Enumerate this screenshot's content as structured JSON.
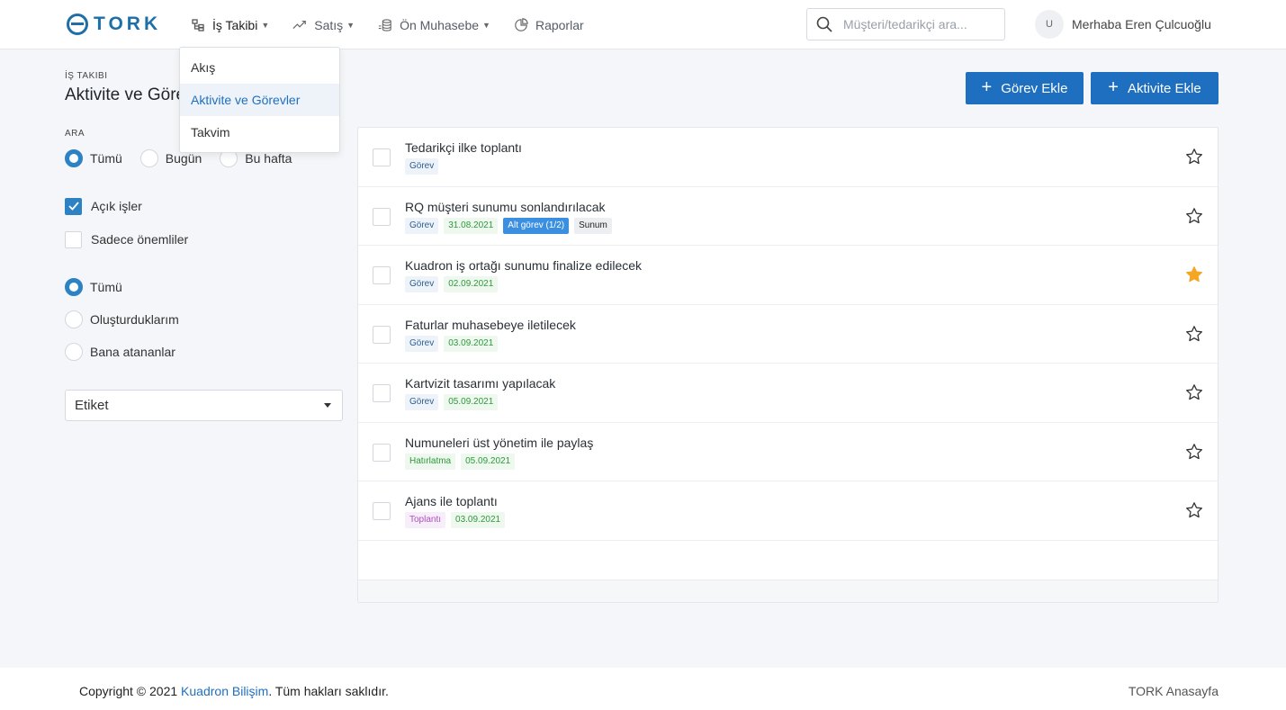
{
  "brand": {
    "name": "TORK",
    "accent": "#1e6fa8"
  },
  "nav": {
    "items": [
      {
        "label": "İş Takibi",
        "icon": "tasks-icon",
        "has_dropdown": true
      },
      {
        "label": "Satış",
        "icon": "trend-up-icon",
        "has_dropdown": true
      },
      {
        "label": "Ön Muhasebe",
        "icon": "coins-icon",
        "has_dropdown": true
      },
      {
        "label": "Raporlar",
        "icon": "pie-chart-icon",
        "has_dropdown": false
      }
    ],
    "dropdown": {
      "items": [
        "Akış",
        "Aktivite ve Görevler",
        "Takvim"
      ],
      "selected": "Aktivite ve Görevler"
    }
  },
  "search": {
    "placeholder": "Müşteri/tedarikçi ara..."
  },
  "user": {
    "initial": "U",
    "greeting": "Merhaba Eren Çulcuoğlu"
  },
  "page": {
    "breadcrumb": "İŞ TAKIBI",
    "title": "Aktivite ve Görevler"
  },
  "filters": {
    "search_label": "ARA",
    "period": {
      "options": [
        "Tümü",
        "Bugün",
        "Bu hafta"
      ],
      "selected": "Tümü"
    },
    "open_tasks": {
      "label": "Açık işler",
      "checked": true
    },
    "important_only": {
      "label": "Sadece önemliler",
      "checked": false
    },
    "owner": {
      "options": [
        "Tümü",
        "Oluşturduklarım",
        "Bana atananlar"
      ],
      "selected": "Tümü"
    },
    "tag_select": {
      "label": "Etiket"
    }
  },
  "actions": {
    "add_task": "Görev Ekle",
    "add_activity": "Aktivite Ekle"
  },
  "tasks": [
    {
      "title": "Tedarikçi ilke toplantı",
      "tags": [
        {
          "text": "Görev",
          "kind": "gorev"
        }
      ],
      "starred": false
    },
    {
      "title": "RQ müşteri sunumu sonlandırılacak",
      "tags": [
        {
          "text": "Görev",
          "kind": "gorev"
        },
        {
          "text": "31.08.2021",
          "kind": "date"
        },
        {
          "text": "Alt görev (1/2)",
          "kind": "alt"
        },
        {
          "text": "Sunum",
          "kind": "sunum"
        }
      ],
      "starred": false
    },
    {
      "title": "Kuadron iş ortağı sunumu finalize edilecek",
      "tags": [
        {
          "text": "Görev",
          "kind": "gorev"
        },
        {
          "text": "02.09.2021",
          "kind": "date"
        }
      ],
      "starred": true
    },
    {
      "title": "Faturlar muhasebeye iletilecek",
      "tags": [
        {
          "text": "Görev",
          "kind": "gorev"
        },
        {
          "text": "03.09.2021",
          "kind": "date"
        }
      ],
      "starred": false
    },
    {
      "title": "Kartvizit tasarımı yapılacak",
      "tags": [
        {
          "text": "Görev",
          "kind": "gorev"
        },
        {
          "text": "05.09.2021",
          "kind": "date"
        }
      ],
      "starred": false
    },
    {
      "title": "Numuneleri üst yönetim ile paylaş",
      "tags": [
        {
          "text": "Hatırlatma",
          "kind": "hatirlatma"
        },
        {
          "text": "05.09.2021",
          "kind": "date"
        }
      ],
      "starred": false
    },
    {
      "title": "Ajans ile toplantı",
      "tags": [
        {
          "text": "Toplantı",
          "kind": "toplanti"
        },
        {
          "text": "03.09.2021",
          "kind": "date"
        }
      ],
      "starred": false
    }
  ],
  "colors": {
    "primary": "#1f6fc0",
    "star": "#f5a623",
    "radio": "#2d82c4"
  },
  "footer": {
    "copyright_prefix": "Copyright © 2021",
    "company": "Kuadron Bilişim",
    "copyright_suffix": ". Tüm hakları saklıdır.",
    "home_link": "TORK Anasayfa"
  }
}
